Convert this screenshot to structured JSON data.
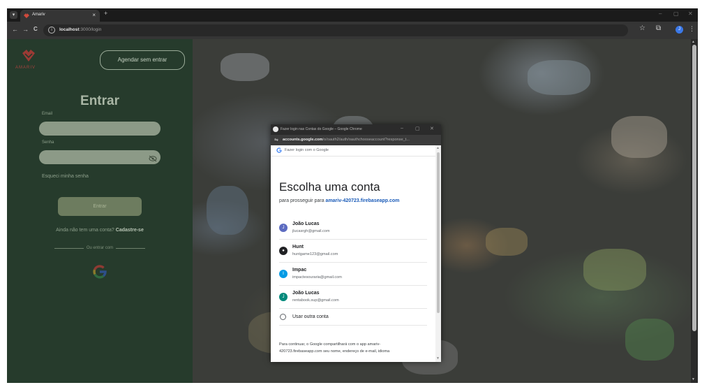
{
  "browser": {
    "tab": {
      "title": "Amariv",
      "close": "×"
    },
    "new_tab": "+",
    "window_controls": {
      "minimize": "–",
      "maximize": "▢",
      "close": "✕"
    },
    "nav": {
      "back": "←",
      "forward": "→",
      "reload": "C"
    },
    "url_host": "localhost",
    "url_rest": ":3000/login",
    "profile_initial": "J"
  },
  "login": {
    "logo_text": "AMARIV",
    "guest_button": "Agendar sem entrar",
    "title": "Entrar",
    "email_label": "Email",
    "password_label": "Senha",
    "forgot_password": "Esqueci minha senha",
    "submit_button": "Entrar",
    "signup_prompt": "Ainda não tem uma conta?",
    "signup_link": "Cadastre-se",
    "divider_text": "Ou entrar com"
  },
  "popup": {
    "window_title": "Fazer login nas Contas do Google – Google Chrome",
    "url_host": "accounts.google.com",
    "url_rest": "/o/oauth2/auth/oauthchooseaccount?response_t...",
    "header": "Fazer login com o Google",
    "title": "Escolha uma conta",
    "continue_prefix": "para prosseguir para",
    "continue_domain": "amariv-420723.firebaseapp.com",
    "accounts": [
      {
        "initial": "J",
        "name": "João Lucas",
        "email": "jlucasrgh@gmail.com",
        "color": "#5c6bc0"
      },
      {
        "initial": "●",
        "name": "Hunt",
        "email": "huntgame123@gmail.com",
        "color": "#202124"
      },
      {
        "initial": "I",
        "name": "Impac",
        "email": "impactesouraria@gmail.com",
        "color": "#039be5"
      },
      {
        "initial": "J",
        "name": "João Lucas",
        "email": "rentabook.sup@gmail.com",
        "color": "#00897b"
      }
    ],
    "other_account": "Usar outra conta",
    "footer_line1": "Para continuar, o Google compartilhará com o app amariv-",
    "footer_line2": "420723.firebaseapp.com seu nome, endereço de e-mail, idioma"
  }
}
